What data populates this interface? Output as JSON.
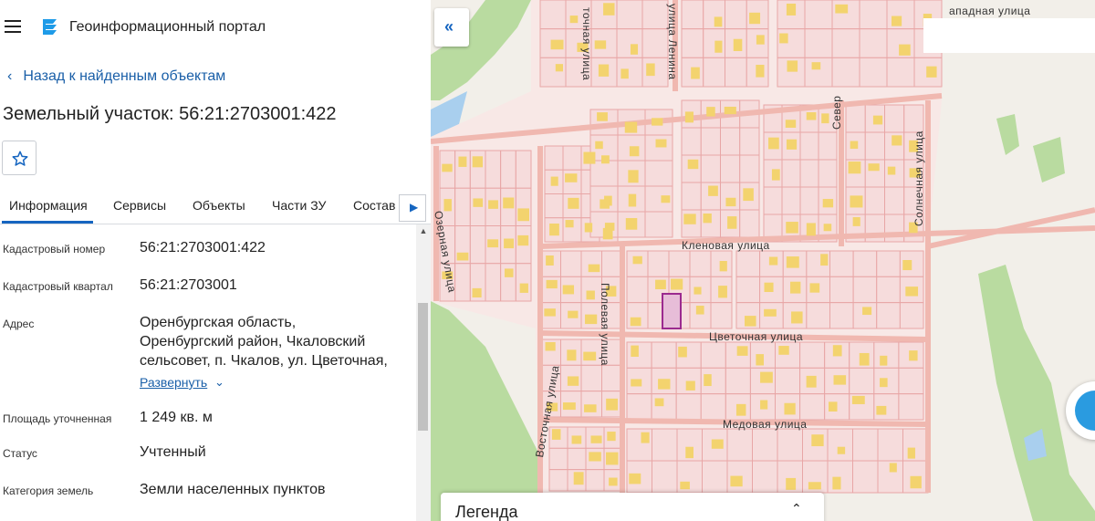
{
  "header": {
    "app_title": "Геоинформационный портал",
    "menu_icon": "hamburger-menu-icon",
    "logo_icon": "portal-logo-icon"
  },
  "nav": {
    "back_label": "Назад к найденным объектам"
  },
  "object": {
    "title": "Земельный участок: 56:21:2703001:422",
    "favorite_icon": "star-outline-icon"
  },
  "tabs": [
    {
      "label": "Информация",
      "active": true
    },
    {
      "label": "Сервисы",
      "active": false
    },
    {
      "label": "Объекты",
      "active": false
    },
    {
      "label": "Части ЗУ",
      "active": false
    },
    {
      "label": "Состав",
      "active": false
    }
  ],
  "properties": {
    "cadastral_number": {
      "label": "Кадастровый номер",
      "value": "56:21:2703001:422"
    },
    "cadastral_block": {
      "label": "Кадастровый квартал",
      "value": "56:21:2703001"
    },
    "address": {
      "label": "Адрес",
      "line1": "Оренбургская область,",
      "line2": "Оренбургский район, Чкаловский",
      "line3": "сельсовет, п. Чкалов, ул. Цветочная,",
      "expand_label": "Развернуть"
    },
    "area": {
      "label": "Площадь уточненная",
      "value": "1 249 кв. м"
    },
    "status": {
      "label": "Статус",
      "value": "Учтенный"
    },
    "land_category": {
      "label": "Категория земель",
      "value": "Земли населенных пунктов"
    }
  },
  "map": {
    "collapse_icon": "double-chevron-left-icon",
    "streets": {
      "klenovaya": "Кленовая улица",
      "tsvetochnaya": "Цветочная улица",
      "medovaya": "Медовая улица",
      "polevaya": "Полевая улица",
      "vostochnaya": "Восточная улица",
      "ozernaya": "Озерная улица",
      "solnechnaya": "Солнечная улица",
      "severnaya": "Север",
      "zapadnaya": "ападная улица",
      "tsvetochnaya_top": "точная улица",
      "lenina": "улица Ленина"
    },
    "legend_title": "Легенда",
    "colors": {
      "parcel_fill": "#f6dcdc",
      "parcel_stroke": "#e8a6a6",
      "selected_fill": "#e7bdd8",
      "selected_stroke": "#9b2a8f",
      "green": "#b9dba0",
      "water": "#a9cfee",
      "building": "#f3d36e",
      "accent": "#1565c0"
    }
  }
}
